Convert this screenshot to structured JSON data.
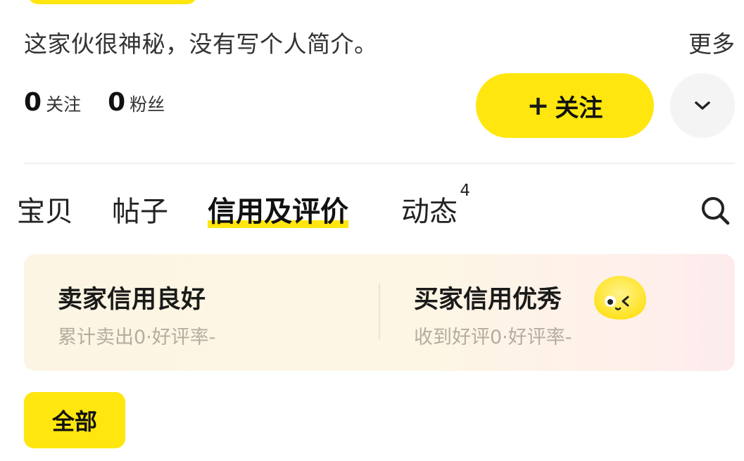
{
  "profile": {
    "bio": "这家伙很神秘，没有写个人简介。",
    "more_label": "更多",
    "stats": [
      {
        "value": "0",
        "label": "关注"
      },
      {
        "value": "0",
        "label": "粉丝"
      }
    ],
    "follow_plus": "+",
    "follow_label": "关注",
    "expand_icon": "chevron-down-icon"
  },
  "tabs": {
    "items": [
      {
        "label": "宝贝"
      },
      {
        "label": "帖子"
      },
      {
        "label": "信用及评价",
        "active": true
      },
      {
        "label": "动态",
        "badge": "4"
      }
    ],
    "search_icon": "search-icon"
  },
  "credit": {
    "seller": {
      "title": "卖家信用良好",
      "sub": "累计卖出0·好评率-"
    },
    "buyer": {
      "title": "买家信用优秀",
      "sub": "收到好评0·好评率-"
    }
  },
  "filters": {
    "active": "全部"
  },
  "colors": {
    "accent_yellow": "#ffe60f",
    "card_bg": "#fdf5e3",
    "muted_text": "#b5aca0"
  }
}
